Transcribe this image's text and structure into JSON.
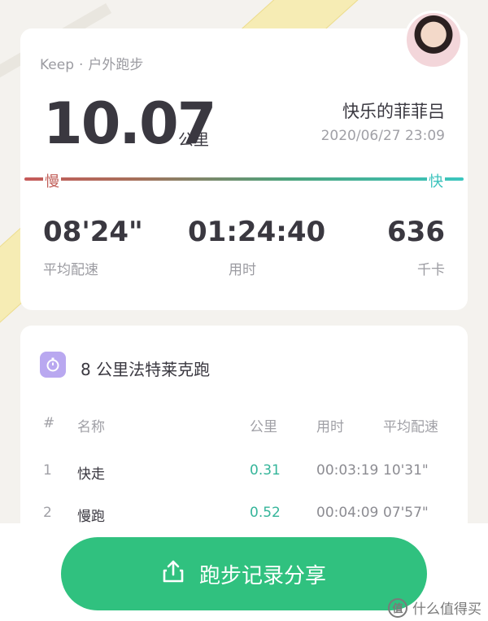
{
  "header": {
    "app_name": "Keep",
    "separator": "·",
    "activity_type": "户外跑步",
    "user_name": "快乐的菲菲吕",
    "datetime": "2020/06/27 23:09"
  },
  "summary": {
    "distance": "10.07",
    "distance_unit": "公里",
    "pace_slow_label": "慢",
    "pace_fast_label": "快",
    "stats": [
      {
        "value": "08'24\"",
        "label": "平均配速"
      },
      {
        "value": "01:24:40",
        "label": "用时"
      },
      {
        "value": "636",
        "label": "千卡"
      }
    ]
  },
  "training": {
    "title": "8 公里法特莱克跑",
    "icon": "stopwatch-icon",
    "columns": [
      "#",
      "名称",
      "公里",
      "用时",
      "平均配速"
    ],
    "rows": [
      {
        "no": "1",
        "name": "快走",
        "km": "0.31",
        "time": "00:03:19",
        "pace": "10'31\""
      },
      {
        "no": "2",
        "name": "慢跑",
        "km": "0.52",
        "time": "00:04:09",
        "pace": "07'57\""
      }
    ]
  },
  "share": {
    "label": "跑步记录分享",
    "icon": "share-icon"
  },
  "watermark": {
    "glyph": "值",
    "text": "什么值得买"
  },
  "colors": {
    "accent": "#30c17f",
    "km_value": "#35b59a",
    "slow": "#c05c56",
    "fast": "#3cc3bd"
  }
}
